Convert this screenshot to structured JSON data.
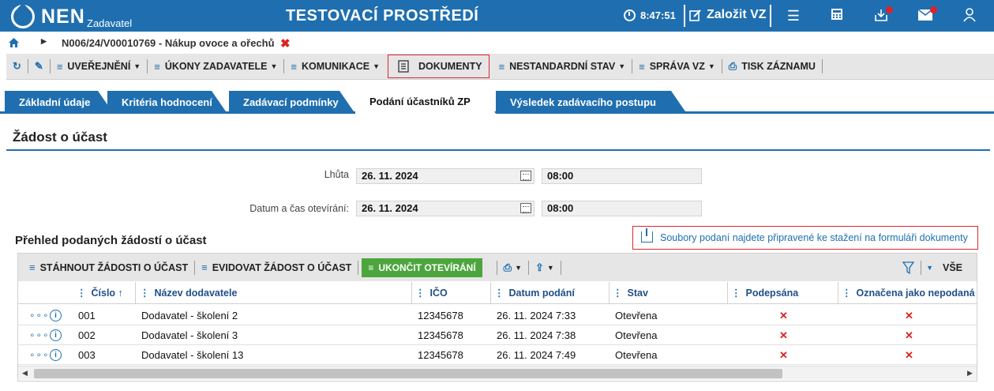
{
  "topbar": {
    "logo": "NEN",
    "logo_sub": "Zadavatel",
    "env_title": "TESTOVACÍ PROSTŘEDÍ",
    "time": "8:47:51",
    "create_label": "Založit VZ",
    "icons": [
      "menu-icon",
      "calculator-icon",
      "inbox-icon",
      "mail-icon",
      "user-icon"
    ]
  },
  "breadcrumb": {
    "path": "N006/24/V00010769 - Nákup ovoce a ořechů"
  },
  "toolbar": {
    "items": [
      {
        "label": "UVEŘEJNĚNÍ"
      },
      {
        "label": "ÚKONY ZADAVATELE"
      },
      {
        "label": "KOMUNIKACE"
      },
      {
        "label": "DOKUMENTY"
      },
      {
        "label": "NESTANDARDNÍ STAV"
      },
      {
        "label": "SPRÁVA VZ"
      },
      {
        "label": "TISK ZÁZNAMU"
      }
    ]
  },
  "tabs": [
    {
      "label": "Základní údaje"
    },
    {
      "label": "Kritéria hodnocení"
    },
    {
      "label": "Zadávací podmínky"
    },
    {
      "label": "Podání účastníků ZP"
    },
    {
      "label": "Výsledek zadávacího postupu"
    }
  ],
  "section": {
    "title": "Žádost o účast",
    "deadline_label": "Lhůta",
    "deadline_date": "26. 11. 2024",
    "deadline_time": "08:00",
    "opening_label": "Datum a čas otevírání:",
    "opening_date": "26. 11. 2024",
    "opening_time": "08:00"
  },
  "overview": {
    "title": "Přehled podaných žádostí o účast",
    "notice": "Soubory podaní najdete připravené ke stažení na formuláři dokumenty",
    "grid_toolbar": {
      "download": "STÁHNOUT ŽÁDOSTI O ÚČAST",
      "record": "EVIDOVAT ŽÁDOST O ÚČAST",
      "finish": "UKONČIT OTEVÍRÁNÍ",
      "all": "VŠE"
    },
    "columns": {
      "number": "Číslo",
      "supplier": "Název dodavatele",
      "ico": "IČO",
      "date": "Datum podání",
      "state": "Stav",
      "signed": "Podepsána",
      "marked": "Označena jako nepodaná"
    },
    "rows": [
      {
        "number": "001",
        "supplier": "Dodavatel - školení 2",
        "ico": "12345678",
        "date": "26. 11. 2024 7:33",
        "state": "Otevřena",
        "signed": "✕",
        "marked": "✕"
      },
      {
        "number": "002",
        "supplier": "Dodavatel - školení 3",
        "ico": "12345678",
        "date": "26. 11. 2024 7:38",
        "state": "Otevřena",
        "signed": "✕",
        "marked": "✕"
      },
      {
        "number": "003",
        "supplier": "Dodavatel - školení 13",
        "ico": "12345678",
        "date": "26. 11. 2024 7:49",
        "state": "Otevřena",
        "signed": "✕",
        "marked": "✕"
      }
    ]
  },
  "colors": {
    "brand": "#1f6fb0",
    "highlight": "#d8272f",
    "green": "#4ca63d"
  }
}
